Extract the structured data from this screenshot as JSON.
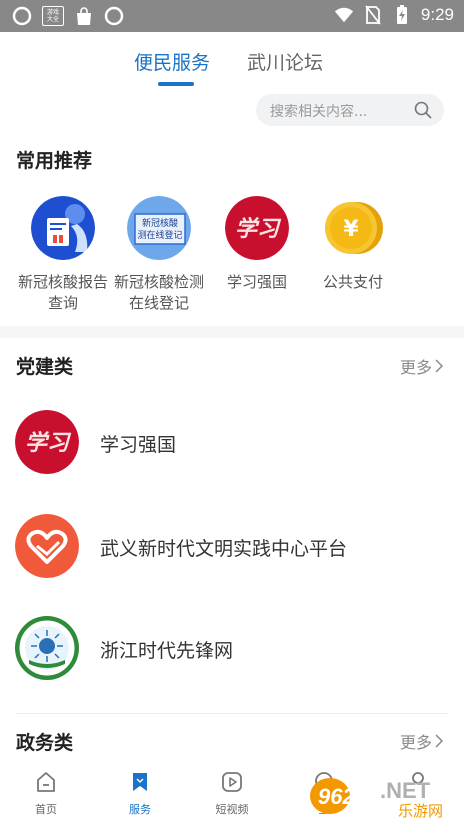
{
  "status_bar": {
    "notif_box_text": "游戏大全",
    "time": "9:29"
  },
  "tabs": [
    {
      "label": "便民服务",
      "active": true
    },
    {
      "label": "武川论坛",
      "active": false
    }
  ],
  "search": {
    "placeholder": "搜索相关内容..."
  },
  "recommend": {
    "title": "常用推荐",
    "items": [
      {
        "label": "新冠核酸报告查询",
        "icon": "nucleic-report-icon"
      },
      {
        "label": "新冠核酸检测在线登记",
        "icon": "nucleic-register-icon",
        "icon_text": "新冠核酸\n测在线登记"
      },
      {
        "label": "学习强国",
        "icon": "xuexi-qiangguo-icon",
        "icon_text": "学习"
      },
      {
        "label": "公共支付",
        "icon": "yuan-coin-icon",
        "icon_text": "¥"
      }
    ]
  },
  "party": {
    "title": "党建类",
    "more_label": "更多",
    "items": [
      {
        "label": "学习强国",
        "icon": "xuexi-qiangguo-icon"
      },
      {
        "label": "武义新时代文明实践中心平台",
        "icon": "heart-hand-icon"
      },
      {
        "label": "浙江时代先锋网",
        "icon": "pioneer-emblem-icon"
      }
    ]
  },
  "gov": {
    "title": "政务类",
    "more_label": "更多"
  },
  "bottom_nav": [
    {
      "label": "首页",
      "icon": "home-icon",
      "active": false
    },
    {
      "label": "服务",
      "icon": "bookmark-icon",
      "active": true
    },
    {
      "label": "短视频",
      "icon": "play-icon",
      "active": false
    },
    {
      "label": "互",
      "icon": "chat-icon",
      "active": false
    }
  ],
  "watermark": {
    "brand": "962",
    "suffix": ".NET",
    "sub": "乐游网"
  },
  "colors": {
    "accent": "#1a73c8",
    "status_bar": "#888888",
    "xuexi_red": "#c8102e",
    "heart_orange": "#f05a3a"
  }
}
